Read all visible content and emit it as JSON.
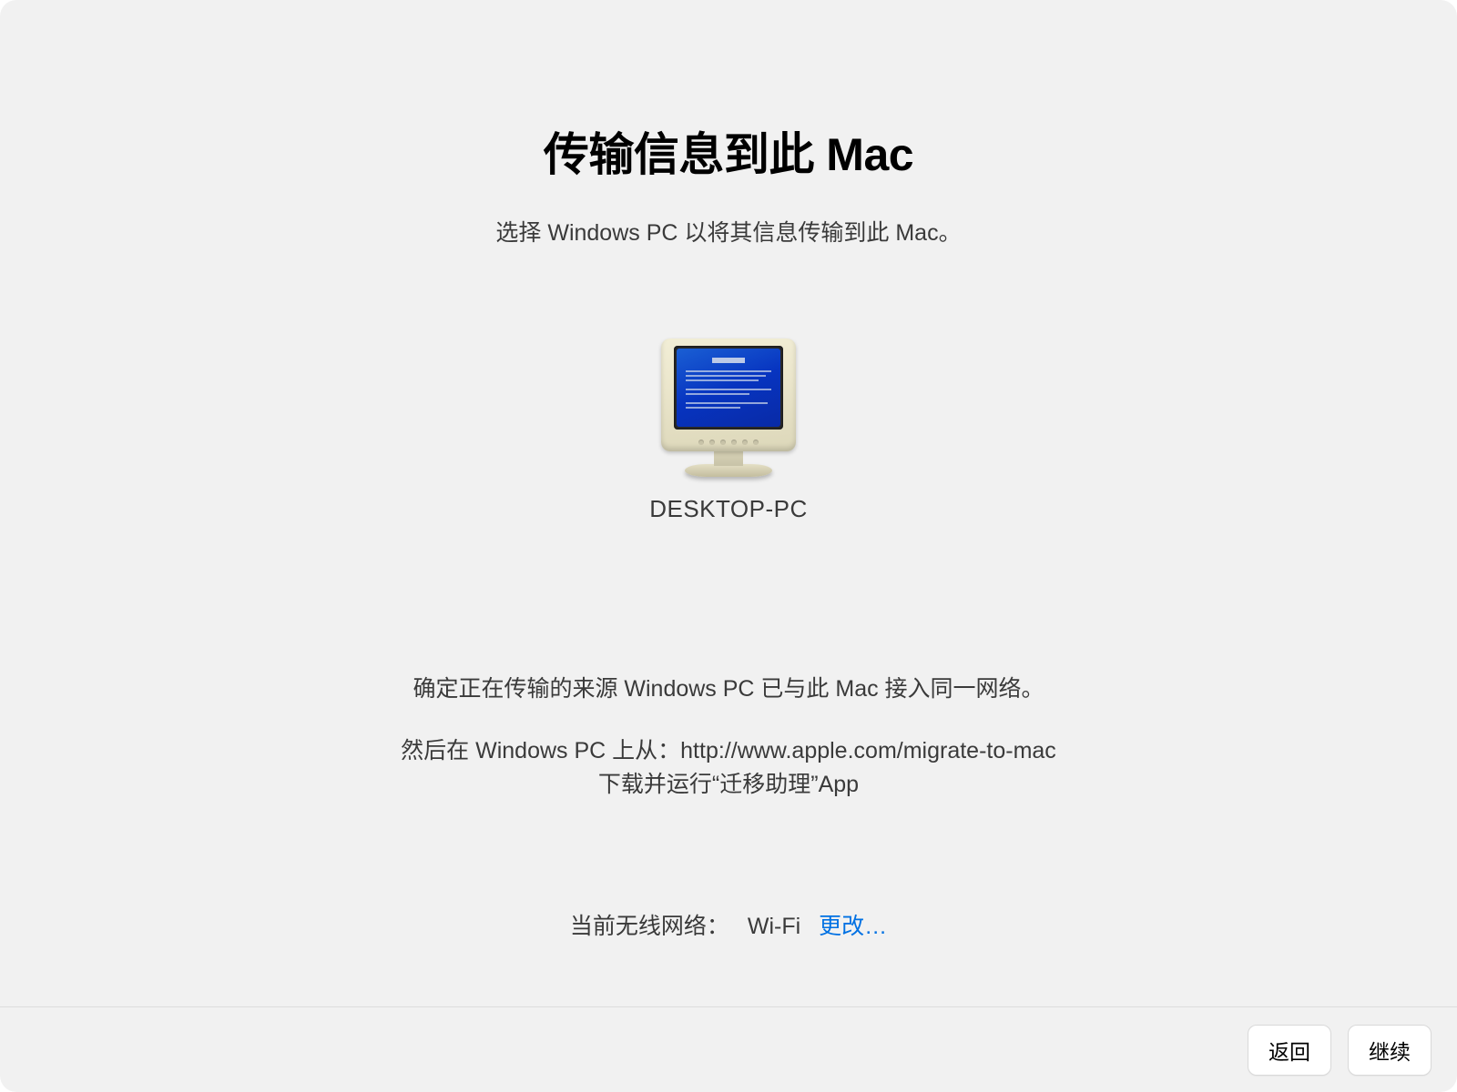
{
  "header": {
    "title": "传输信息到此 Mac",
    "subtitle": "选择 Windows PC 以将其信息传输到此 Mac。"
  },
  "device": {
    "label": "DESKTOP-PC"
  },
  "instructions": {
    "line1": "确定正在传输的来源 Windows PC 已与此 Mac 接入同一网络。",
    "line2": "然后在 Windows PC 上从：http://www.apple.com/migrate-to-mac",
    "line3": "下载并运行“迁移助理”App"
  },
  "network": {
    "label": "当前无线网络：",
    "value": "Wi-Fi",
    "change_label": "更改…"
  },
  "footer": {
    "back_label": "返回",
    "continue_label": "继续"
  }
}
